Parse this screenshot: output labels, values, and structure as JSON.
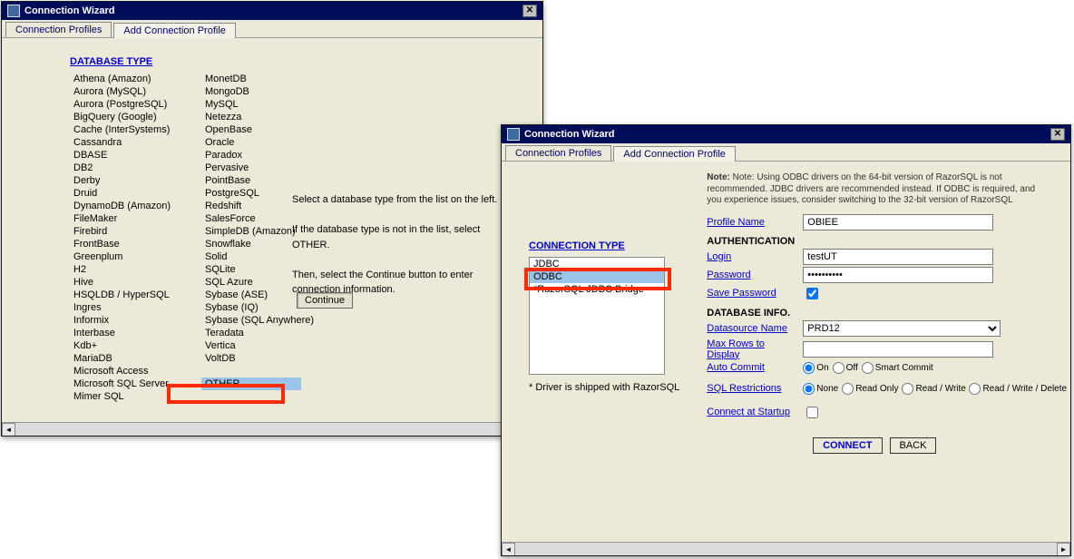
{
  "w1": {
    "title": "Connection Wizard",
    "tabs": [
      "Connection Profiles",
      "Add Connection Profile"
    ],
    "active_tab": 1,
    "heading": "DATABASE TYPE",
    "db_col1": [
      "Athena (Amazon)",
      "Aurora (MySQL)",
      "Aurora (PostgreSQL)",
      "BigQuery (Google)",
      "Cache (InterSystems)",
      "Cassandra",
      "DBASE",
      "DB2",
      "Derby",
      "Druid",
      "DynamoDB (Amazon)",
      "FileMaker",
      "Firebird",
      "FrontBase",
      "Greenplum",
      "H2",
      "Hive",
      "HSQLDB / HyperSQL",
      "Ingres",
      "Informix",
      "Interbase",
      "Kdb+",
      "MariaDB",
      "Microsoft Access",
      "Microsoft SQL Server",
      "Mimer SQL"
    ],
    "db_col2": [
      "MonetDB",
      "MongoDB",
      "MySQL",
      "Netezza",
      "OpenBase",
      "Oracle",
      "Paradox",
      "Pervasive",
      "PointBase",
      "PostgreSQL",
      "Redshift",
      "SalesForce",
      "SimpleDB (Amazon)",
      "Snowflake",
      "Solid",
      "SQLite",
      "SQL Azure",
      "Sybase (ASE)",
      "Sybase (IQ)",
      "Sybase (SQL Anywhere)",
      "Teradata",
      "Vertica",
      "VoltDB",
      "",
      "OTHER"
    ],
    "hint1": "Select a database type from the list on the left.",
    "hint2": "If the database type is not in the list, select OTHER.",
    "hint3": "Then, select the Continue button to enter connection information.",
    "continue": "Continue"
  },
  "w2": {
    "title": "Connection Wizard",
    "tabs": [
      "Connection Profiles",
      "Add Connection Profile"
    ],
    "active_tab": 1,
    "heading": "CONNECTION TYPE",
    "conn_types": [
      "JDBC",
      "ODBC",
      "*RazorSQL JDBC Bridge"
    ],
    "selected_conn": 1,
    "driver_note": "* Driver is shipped with RazorSQL",
    "note": "Note: Using ODBC drivers on the 64-bit version of RazorSQL is not recommended. JDBC drivers are recommended instead. If ODBC is required, and you experience issues, consider switching to the 32-bit version of RazorSQL",
    "labels": {
      "profile_name": "Profile Name",
      "authentication": "AUTHENTICATION",
      "login": "Login",
      "password": "Password",
      "save_password": "Save Password",
      "db_info": "DATABASE INFO.",
      "datasource": "Datasource Name",
      "max_rows": "Max Rows to Display",
      "auto_commit": "Auto Commit",
      "sql_restrictions": "SQL Restrictions",
      "connect_startup": "Connect at Startup "
    },
    "values": {
      "profile_name": "OBIEE",
      "login": "testUT",
      "password": "••••••••••",
      "save_password_checked": true,
      "datasource": "PRD12",
      "max_rows": "",
      "auto_commit": "On",
      "sql_restrictions": "None",
      "connect_startup_checked": false
    },
    "auto_commit_options": [
      "On",
      "Off",
      "Smart Commit"
    ],
    "sql_restriction_options": [
      "None",
      "Read Only",
      "Read / Write",
      "Read / Write / Delete"
    ],
    "buttons": {
      "connect": "CONNECT",
      "back": "BACK"
    }
  }
}
